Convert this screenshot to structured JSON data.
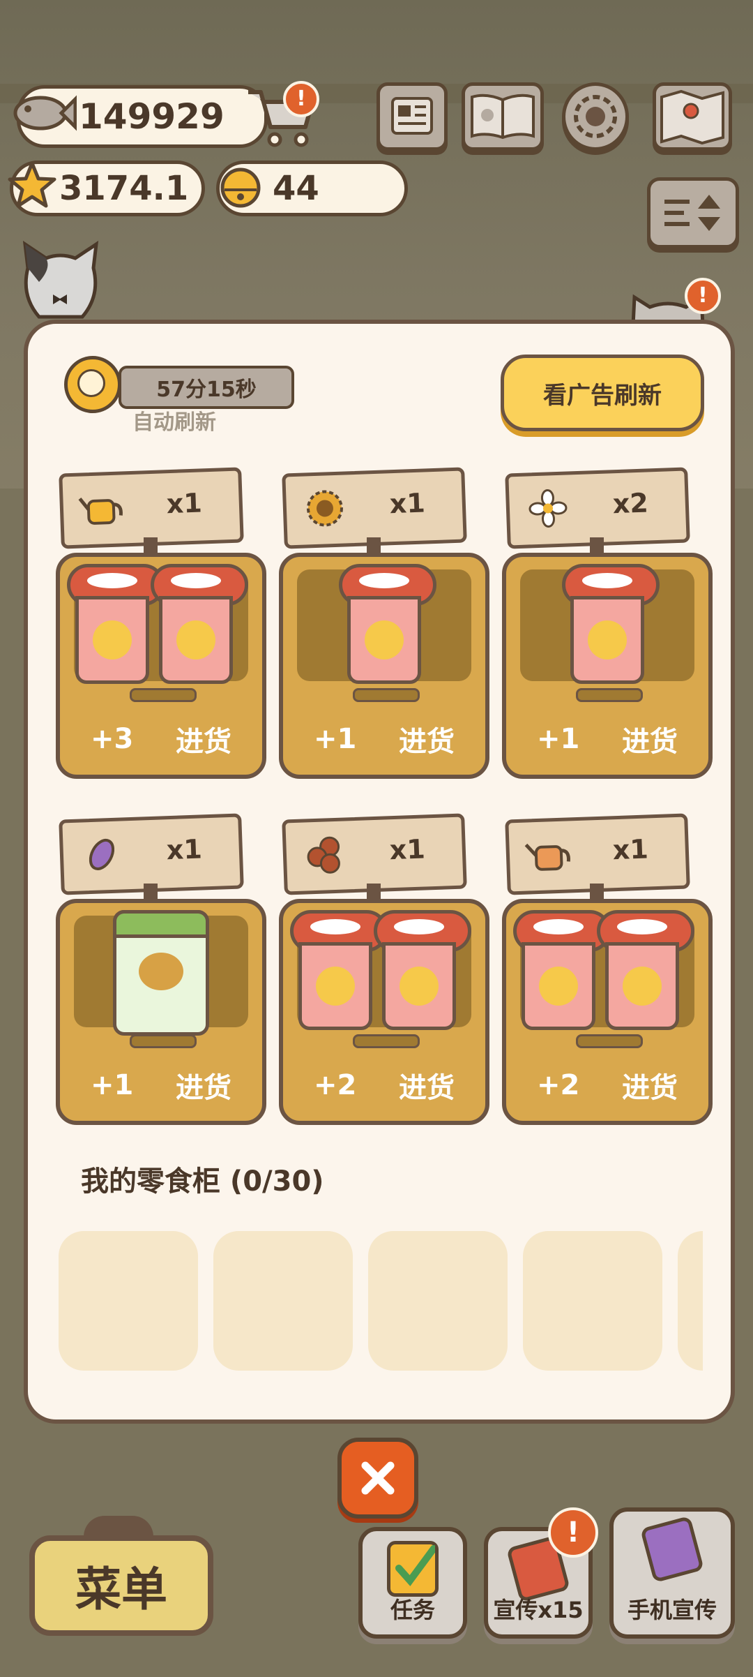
{
  "currencies": {
    "fish": "149929",
    "stars": "3174.1",
    "bells": "44"
  },
  "badges": {
    "cart": "!",
    "cat": "!",
    "promo": "!"
  },
  "timer": {
    "remaining": "57分15秒",
    "label": "自动刷新"
  },
  "ad_refresh_label": "看广告刷新",
  "slots": [
    {
      "sign_item": "watering-can",
      "sign_qty": "x1",
      "stock": "+3",
      "restock": "进货",
      "product": "cup-noodles"
    },
    {
      "sign_item": "sunflower",
      "sign_qty": "x1",
      "stock": "+1",
      "restock": "进货",
      "product": "cup-noodles"
    },
    {
      "sign_item": "white-flower",
      "sign_qty": "x2",
      "stock": "+1",
      "restock": "进货",
      "product": "cup-noodles"
    },
    {
      "sign_item": "purple-fish",
      "sign_qty": "x1",
      "stock": "+1",
      "restock": "进货",
      "product": "snack-can"
    },
    {
      "sign_item": "pinecones",
      "sign_qty": "x1",
      "stock": "+2",
      "restock": "进货",
      "product": "cup-noodles"
    },
    {
      "sign_item": "orange-watering-can",
      "sign_qty": "x1",
      "stock": "+2",
      "restock": "进货",
      "product": "cup-noodles"
    }
  ],
  "cabinet": {
    "title": "我的零食柜 (0/30)"
  },
  "bottom": {
    "menu": "菜单",
    "tasks": "任务",
    "promo": "宣传x15",
    "phone_promo": "手机宣传"
  },
  "colors": {
    "accent": "#fbd15a",
    "close": "#e55e22",
    "panel": "#fcf5ec",
    "outline": "#6b5443"
  }
}
